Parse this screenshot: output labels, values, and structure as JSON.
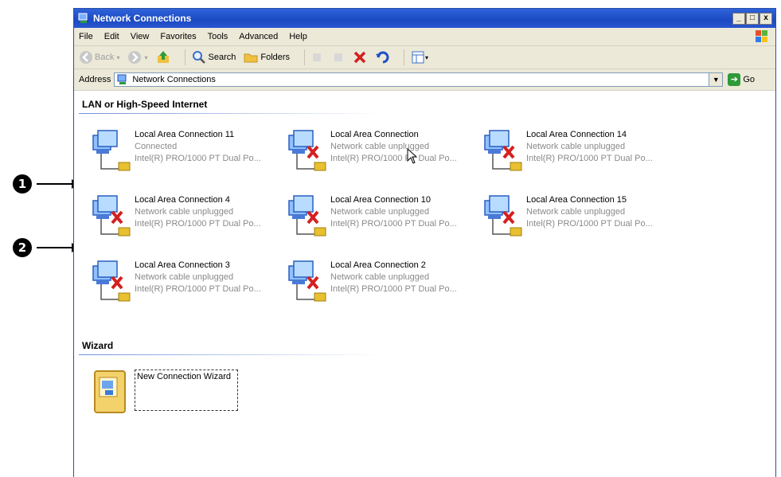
{
  "callouts": [
    {
      "label": "1"
    },
    {
      "label": "2"
    }
  ],
  "window": {
    "title": "Network Connections",
    "buttons": [
      "_",
      "□",
      "x"
    ]
  },
  "menu": [
    "File",
    "Edit",
    "View",
    "Favorites",
    "Tools",
    "Advanced",
    "Help"
  ],
  "toolbar": {
    "back": "Back",
    "search": "Search",
    "folders": "Folders"
  },
  "address": {
    "label": "Address",
    "value": "Network Connections",
    "go": "Go"
  },
  "groups": {
    "lan": "LAN or High-Speed Internet",
    "wizard": "Wizard"
  },
  "connections": [
    {
      "name": "Local Area Connection 11",
      "status": "Connected",
      "device": "Intel(R) PRO/1000 PT Dual Po..."
    },
    {
      "name": "Local Area Connection",
      "status": "Network cable unplugged",
      "device": "Intel(R) PRO/1000 PT Dual Po..."
    },
    {
      "name": "Local Area Connection 14",
      "status": "Network cable unplugged",
      "device": "Intel(R) PRO/1000 PT Dual Po..."
    },
    {
      "name": "Local Area Connection 4",
      "status": "Network cable unplugged",
      "device": "Intel(R) PRO/1000 PT Dual Po..."
    },
    {
      "name": "Local Area Connection 10",
      "status": "Network cable unplugged",
      "device": "Intel(R) PRO/1000 PT Dual Po..."
    },
    {
      "name": "Local Area Connection 15",
      "status": "Network cable unplugged",
      "device": "Intel(R) PRO/1000 PT Dual Po..."
    },
    {
      "name": "Local Area Connection 3",
      "status": "Network cable unplugged",
      "device": "Intel(R) PRO/1000 PT Dual Po..."
    },
    {
      "name": "Local Area Connection 2",
      "status": "Network cable unplugged",
      "device": "Intel(R) PRO/1000 PT Dual Po..."
    }
  ],
  "wizard": {
    "label": "New Connection Wizard"
  },
  "colors": {
    "titlebar": "#1b49c3",
    "chrome": "#ece9d8",
    "error": "#d42020"
  }
}
